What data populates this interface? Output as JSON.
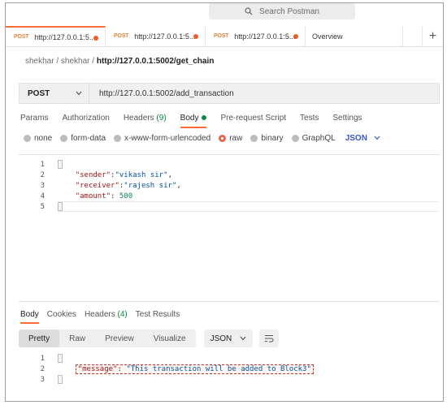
{
  "search": {
    "placeholder": "Search Postman"
  },
  "tabs": [
    {
      "method": "POST",
      "url": "http://127.0.0.1:5...",
      "unsaved": true
    },
    {
      "method": "POST",
      "url": "http://127.0.0.1:5...",
      "unsaved": true
    },
    {
      "method": "POST",
      "url": "http://127.0.0.1:5...",
      "unsaved": true
    },
    {
      "label": "Overview"
    }
  ],
  "new_tab_label": "+",
  "breadcrumb": {
    "part1": "shekhar",
    "sep1": "/",
    "part2": "shekhar",
    "sep2": "/",
    "current": "http://127.0.0.1:5002/get_chain"
  },
  "request": {
    "method": "POST",
    "url": "http://127.0.0.1:5002/add_transaction"
  },
  "request_tabs": {
    "params": "Params",
    "authorization": "Authorization",
    "headers": "Headers",
    "headers_count": "(9)",
    "body": "Body",
    "pre_request": "Pre-request Script",
    "tests": "Tests",
    "settings": "Settings"
  },
  "body_types": {
    "none": "none",
    "form_data": "form-data",
    "urlencoded": "x-www-form-urlencoded",
    "raw": "raw",
    "binary": "binary",
    "graphql": "GraphQL",
    "format": "JSON",
    "selected": "raw"
  },
  "request_body": {
    "line_numbers": [
      "1",
      "2",
      "3",
      "4",
      "5"
    ],
    "open_brace": "{",
    "k1": "\"sender\"",
    "v1": "\"vikash sir\"",
    "k2": "\"receiver\"",
    "v2": "\"rajesh sir\"",
    "k3": "\"amount\"",
    "v3": "500",
    "close_brace": "}"
  },
  "response_tabs": {
    "body": "Body",
    "cookies": "Cookies",
    "headers": "Headers",
    "headers_count": "(4)",
    "test_results": "Test Results"
  },
  "response_view": {
    "pretty": "Pretty",
    "raw": "Raw",
    "preview": "Preview",
    "visualize": "Visualize",
    "format": "JSON"
  },
  "response_body": {
    "line_numbers": [
      "1",
      "2",
      "3"
    ],
    "open_brace": "{",
    "key": "\"message\"",
    "value": "\"This transaction will be added to Block3\"",
    "close_brace": "}"
  },
  "colors": {
    "accent": "#ff6c37",
    "method_orange": "#e4843b",
    "green": "#0a8a3e",
    "json_blue": "#3b55c9"
  }
}
